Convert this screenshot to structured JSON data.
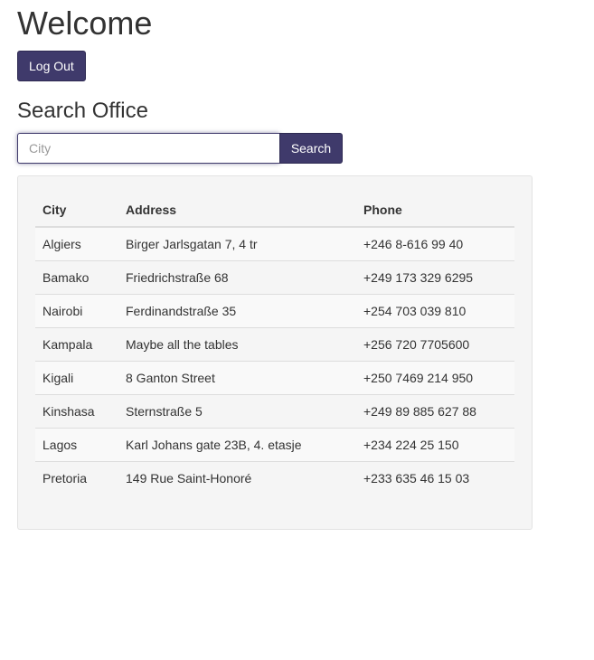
{
  "header": {
    "title": "Welcome",
    "logout_label": "Log Out"
  },
  "search": {
    "title": "Search Office",
    "placeholder": "City",
    "value": "",
    "button_label": "Search"
  },
  "colors": {
    "accent": "#3f3a6b",
    "well_background": "#f5f5f5"
  },
  "table": {
    "columns": [
      "City",
      "Address",
      "Phone"
    ],
    "rows": [
      {
        "city": "Algiers",
        "address": "Birger Jarlsgatan 7, 4 tr",
        "phone": "+246 8-616 99 40"
      },
      {
        "city": "Bamako",
        "address": "Friedrichstraße 68",
        "phone": "+249 173 329 6295"
      },
      {
        "city": "Nairobi",
        "address": "Ferdinandstraße 35",
        "phone": "+254 703 039 810"
      },
      {
        "city": "Kampala",
        "address": "Maybe all the tables",
        "phone": "+256 720 7705600"
      },
      {
        "city": "Kigali",
        "address": "8 Ganton Street",
        "phone": "+250 7469 214 950"
      },
      {
        "city": "Kinshasa",
        "address": "Sternstraße 5",
        "phone": "+249 89 885 627 88"
      },
      {
        "city": "Lagos",
        "address": "Karl Johans gate 23B, 4. etasje",
        "phone": "+234 224 25 150"
      },
      {
        "city": "Pretoria",
        "address": "149 Rue Saint-Honoré",
        "phone": "+233 635 46 15 03"
      }
    ]
  }
}
